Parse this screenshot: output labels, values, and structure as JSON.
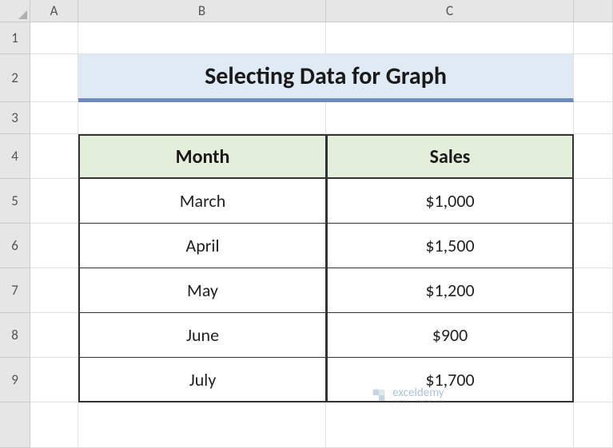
{
  "columns": [
    "A",
    "B",
    "C"
  ],
  "rows": [
    "1",
    "2",
    "3",
    "4",
    "5",
    "6",
    "7",
    "8",
    "9"
  ],
  "title": "Selecting Data for Graph",
  "table": {
    "headers": [
      "Month",
      "Sales"
    ],
    "data": [
      {
        "month": "March",
        "sales": "$1,000"
      },
      {
        "month": "April",
        "sales": "$1,500"
      },
      {
        "month": "May",
        "sales": "$1,200"
      },
      {
        "month": "June",
        "sales": "$900"
      },
      {
        "month": "July",
        "sales": "$1,700"
      }
    ]
  },
  "watermark": {
    "main": "exceldemy",
    "sub": "EXCEL · DATA · BI"
  },
  "chart_data": {
    "type": "table",
    "title": "Selecting Data for Graph",
    "categories": [
      "March",
      "April",
      "May",
      "June",
      "July"
    ],
    "series": [
      {
        "name": "Sales",
        "values": [
          1000,
          1500,
          1200,
          900,
          1700
        ]
      }
    ],
    "xlabel": "Month",
    "ylabel": "Sales"
  }
}
